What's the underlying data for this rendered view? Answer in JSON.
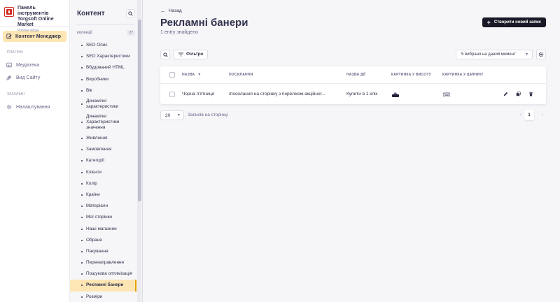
{
  "brand": {
    "title_line1": "Панель інструментів",
    "title_line2": "Torgsoft Online Market",
    "subtitle": "Робоче місце"
  },
  "mainnav": {
    "active_item": "Контент Менеджер",
    "plugins_section": "ПЛАГІНИ",
    "plugins": [
      "Медіатека",
      "Вид Сайту"
    ],
    "general_section": "ЗАГАЛЬНІ",
    "general": [
      "Налаштування"
    ]
  },
  "subnav": {
    "title": "Контент",
    "collections_label": "колекції",
    "collections_count": "27",
    "items": [
      "SEO Опис",
      "SEO Характеристики",
      "Вбудований HTML",
      "Виробники",
      "Вік",
      "Динамічні характеристики",
      "Динамічні Характеристики значення",
      "Живлення",
      "Замовлення",
      "Категорії",
      "Клієнти",
      "Колір",
      "Країни",
      "Матеріали",
      "Мої сторінки",
      "Наші магазини",
      "Обране",
      "Пакування",
      "Перенаправлення",
      "Пошукова оптимізація",
      "Рекламні банери",
      "Розміри"
    ],
    "active_index": 20
  },
  "main": {
    "back_label": "Назад",
    "title": "Рекламні банери",
    "subtitle": "1 entry знайдено",
    "create_label": "Створити новий запис",
    "filters_label": "Фільтри",
    "columns_select": "5 вибрано на даний момент",
    "table": {
      "headers": [
        "НАЗВА",
        "ПОСИЛАННЯ",
        "НАЗВА ДІЇ",
        "КАРТИНКА У ВИСОТУ",
        "КАРТИНКА У ШИРИНУ"
      ],
      "rows": [
        {
          "name": "Чорна п'ятниця",
          "link": "/посилання на сторінку з переліком акційног...",
          "action": "Купити в 1 клік"
        }
      ]
    },
    "pagination": {
      "page_size": "20",
      "page_size_label": "Записів на сторінці",
      "current_page": "1"
    }
  },
  "colors": {
    "accent_active": "#fde6b3",
    "primary_dark": "#181826",
    "text": "#32324d",
    "muted": "#666687"
  }
}
